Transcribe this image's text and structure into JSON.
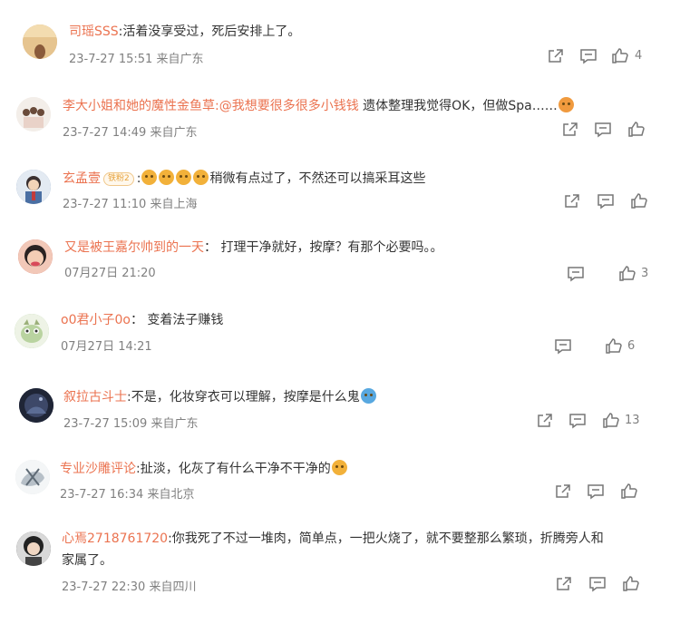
{
  "comments": [
    {
      "username": "司瑶SSS",
      "mention": "",
      "text": ":活着没享受过，死后安排上了。",
      "text2": "",
      "time": "23-7-27 15:51",
      "location": "来自广东",
      "likes": "4",
      "avatar_color": "#d9b27c"
    },
    {
      "username": "李大小姐和她的魔性金鱼草",
      "mention": ":@我想要很多很多小钱钱",
      "text": " 遗体整理我觉得OK，但做Spa……",
      "text2": "",
      "time": "23-7-27 14:49",
      "location": "来自广东",
      "likes": "",
      "avatar_color": "#e8ded8"
    },
    {
      "username": "玄孟壹",
      "badge": "铁粉2",
      "mention": "",
      "text": "稍微有点过了，不然还可以搞采耳这些",
      "text2": "",
      "time": "23-7-27 11:10",
      "location": "来自上海",
      "likes": "",
      "avatar_color": "#6d8cb5"
    },
    {
      "username": "又是被王嘉尔帅到的一天",
      "mention": "",
      "text": "： 打理干净就好，按摩？有那个必要吗。。",
      "text2": "",
      "time": "07月27日 21:20",
      "location": "",
      "likes": "3",
      "avatar_color": "#c9534a"
    },
    {
      "username": "o0君小子0o",
      "mention": "",
      "text": "： 变着法子赚钱",
      "text2": "",
      "time": "07月27日 14:21",
      "location": "",
      "likes": "6",
      "avatar_color": "#9cc48a"
    },
    {
      "username": "叙拉古斗士",
      "mention": "",
      "text": ":不是，化妆穿衣可以理解，按摩是什么鬼",
      "text2": "",
      "time": "23-7-27 15:09",
      "location": "来自广东",
      "likes": "13",
      "avatar_color": "#2b3550"
    },
    {
      "username": "专业沙雕评论",
      "mention": "",
      "text": ":扯淡，化灰了有什么干净不干净的",
      "text2": "",
      "time": "23-7-27 16:34",
      "location": "来自北京",
      "likes": "",
      "avatar_color": "#d8dde0"
    },
    {
      "username": "心焉2718761720",
      "mention": "",
      "text": ":你我死了不过一堆肉，简单点，一把火烧了，就不要整那么繁琐，折腾旁人和",
      "text2": "家属了。",
      "time": "23-7-27 22:30",
      "location": "来自四川",
      "likes": "",
      "avatar_color": "#3c3c3c"
    }
  ],
  "icons": {
    "share": "share-icon",
    "comment": "comment-icon",
    "like": "like-icon"
  },
  "colors": {
    "username": "#eb7350",
    "meta": "#808080",
    "text": "#333333"
  }
}
